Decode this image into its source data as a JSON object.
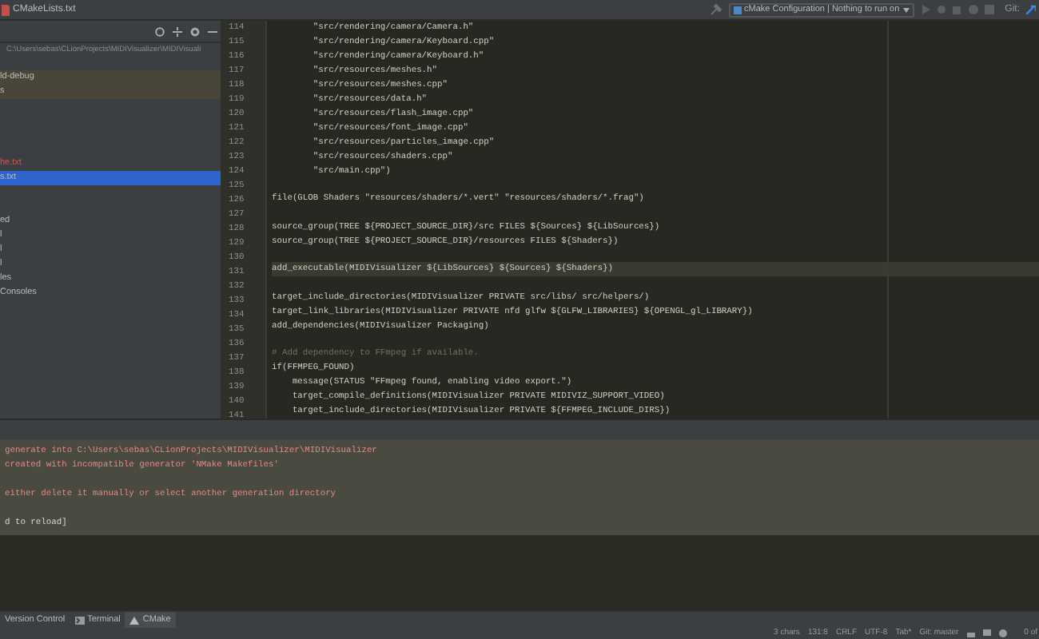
{
  "title_bar": {
    "file_tab": "CMakeLists.txt"
  },
  "toolbar": {
    "run_config": "cMake Configuration | Nothing to run on",
    "git_label": "Git:"
  },
  "project_panel": {
    "path": "C:\\Users\\sebas\\CLionProjects\\MIDIVisualizer\\MIDIVisuali",
    "items": [
      {
        "label": "ld-debug",
        "kind": "excluded",
        "selected": false
      },
      {
        "label": "s",
        "kind": "excluded",
        "selected": false
      },
      {
        "kind": "blank",
        "selected": false
      },
      {
        "kind": "blank",
        "selected": false
      },
      {
        "kind": "blank",
        "selected": false
      },
      {
        "kind": "blank",
        "selected": false
      },
      {
        "label": "he.txt",
        "kind": "untracked",
        "selected": false
      },
      {
        "label": "s.txt",
        "kind": "normal",
        "selected": true
      },
      {
        "kind": "blank",
        "selected": false
      },
      {
        "kind": "blank",
        "selected": false
      },
      {
        "label": "ed",
        "kind": "normal",
        "selected": false
      },
      {
        "label": "l",
        "kind": "normal",
        "selected": false
      },
      {
        "label": "l",
        "kind": "normal",
        "selected": false
      },
      {
        "label": "l",
        "kind": "normal",
        "selected": false
      },
      {
        "label": "les",
        "kind": "normal",
        "selected": false
      },
      {
        "label": "Consoles",
        "kind": "normal",
        "selected": false
      }
    ]
  },
  "editor": {
    "lines": [
      {
        "number": "114",
        "text": "        \"src/rendering/camera/Camera.h\"",
        "kind": "code",
        "current": false
      },
      {
        "number": "115",
        "text": "        \"src/rendering/camera/Keyboard.cpp\"",
        "kind": "code",
        "current": false
      },
      {
        "number": "116",
        "text": "        \"src/rendering/camera/Keyboard.h\"",
        "kind": "code",
        "current": false
      },
      {
        "number": "117",
        "text": "        \"src/resources/meshes.h\"",
        "kind": "code",
        "current": false
      },
      {
        "number": "118",
        "text": "        \"src/resources/meshes.cpp\"",
        "kind": "code",
        "current": false
      },
      {
        "number": "119",
        "text": "        \"src/resources/data.h\"",
        "kind": "code",
        "current": false
      },
      {
        "number": "120",
        "text": "        \"src/resources/flash_image.cpp\"",
        "kind": "code",
        "current": false
      },
      {
        "number": "121",
        "text": "        \"src/resources/font_image.cpp\"",
        "kind": "code",
        "current": false
      },
      {
        "number": "122",
        "text": "        \"src/resources/particles_image.cpp\"",
        "kind": "code",
        "current": false
      },
      {
        "number": "123",
        "text": "        \"src/resources/shaders.cpp\"",
        "kind": "code",
        "current": false
      },
      {
        "number": "124",
        "text": "        \"src/main.cpp\")",
        "kind": "code",
        "current": false
      },
      {
        "number": "125",
        "kind": "blank",
        "current": false
      },
      {
        "number": "126",
        "text": "file(GLOB Shaders \"resources/shaders/*.vert\" \"resources/shaders/*.frag\")",
        "kind": "code",
        "current": false
      },
      {
        "number": "127",
        "kind": "blank",
        "current": false
      },
      {
        "number": "128",
        "text": "source_group(TREE ${PROJECT_SOURCE_DIR}/src FILES ${Sources} ${LibSources})",
        "kind": "code",
        "current": false
      },
      {
        "number": "129",
        "text": "source_group(TREE ${PROJECT_SOURCE_DIR}/resources FILES ${Shaders})",
        "kind": "code",
        "current": false
      },
      {
        "number": "130",
        "kind": "blank",
        "current": false
      },
      {
        "number": "131",
        "text": "add_executable(MIDIVisualizer ${LibSources} ${Sources} ${Shaders})",
        "kind": "code",
        "current": true
      },
      {
        "number": "132",
        "kind": "blank",
        "current": false
      },
      {
        "number": "133",
        "text": "target_include_directories(MIDIVisualizer PRIVATE src/libs/ src/helpers/)",
        "kind": "code",
        "current": false
      },
      {
        "number": "134",
        "text": "target_link_libraries(MIDIVisualizer PRIVATE nfd glfw ${GLFW_LIBRARIES} ${OPENGL_gl_LIBRARY})",
        "kind": "code",
        "current": false
      },
      {
        "number": "135",
        "text": "add_dependencies(MIDIVisualizer Packaging)",
        "kind": "code",
        "current": false
      },
      {
        "number": "136",
        "kind": "blank",
        "current": false
      },
      {
        "number": "137",
        "text": "# Add dependency to FFmpeg if available.",
        "kind": "comment",
        "current": false
      },
      {
        "number": "138",
        "text": "if(FFMPEG_FOUND)",
        "kind": "code",
        "current": false
      },
      {
        "number": "139",
        "text": "    message(STATUS \"FFmpeg found, enabling video export.\")",
        "kind": "code",
        "current": false
      },
      {
        "number": "140",
        "text": "    target_compile_definitions(MIDIVisualizer PRIVATE MIDIVIZ_SUPPORT_VIDEO)",
        "kind": "code",
        "current": false
      },
      {
        "number": "141",
        "text": "    target_include_directories(MIDIVisualizer PRIVATE ${FFMPEG_INCLUDE_DIRS})",
        "kind": "code",
        "current": false
      }
    ]
  },
  "cmake_panel": {
    "messages": [
      {
        "text": "generate into C:\\Users\\sebas\\CLionProjects\\MIDIVisualizer\\MIDIVisualizer",
        "kind": "error"
      },
      {
        "text": "created with incompatible generator 'NMake Makefiles'",
        "kind": "error"
      },
      {
        "kind": "blank"
      },
      {
        "text": "either delete it manually or select another generation directory",
        "kind": "error"
      },
      {
        "kind": "blank"
      },
      {
        "text": "d to reload]",
        "kind": "plain"
      }
    ]
  },
  "tool_tabs": [
    {
      "label": "Version Control",
      "kind": "text",
      "selected": false
    },
    {
      "label": "Terminal",
      "kind": "terminal",
      "selected": false
    },
    {
      "label": "CMake",
      "kind": "warning",
      "selected": true
    }
  ],
  "status_bar": {
    "items": [
      "3 chars",
      "131:8",
      "CRLF",
      "UTF-8",
      "Tab*",
      "Git: master"
    ],
    "page": "0 of"
  }
}
